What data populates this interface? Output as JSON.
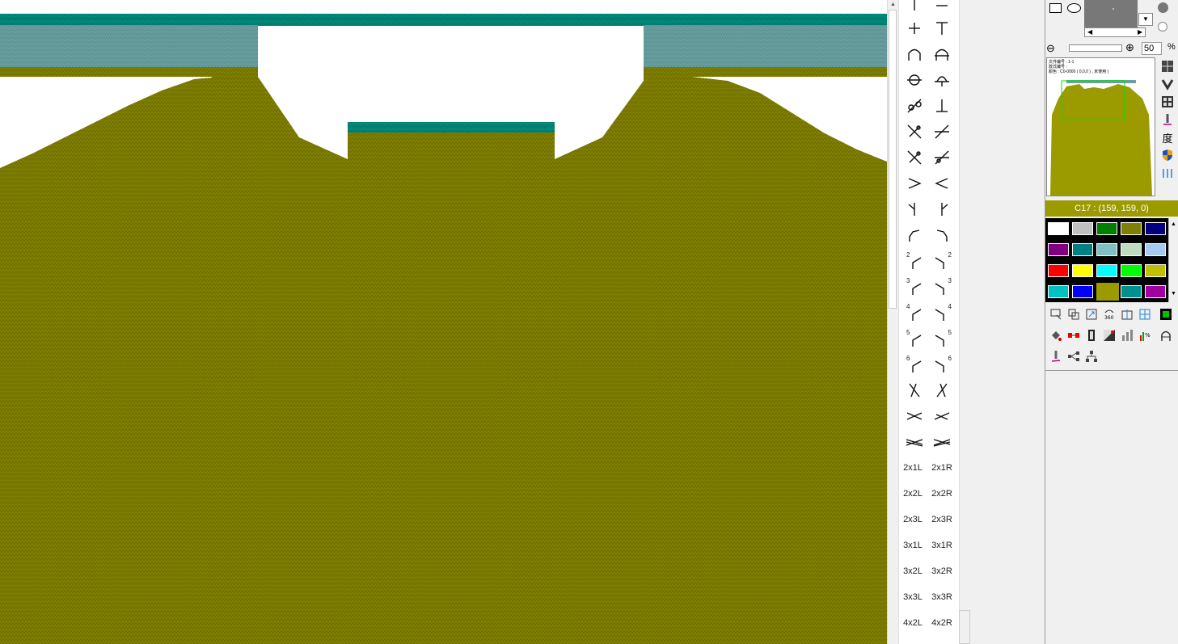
{
  "editor": {
    "colors": {
      "knit": "#808000",
      "knit_dark": "#6a6a00",
      "rib": "#6aa0a0",
      "rib_stripe": "#00897a",
      "background": "#ffffff"
    }
  },
  "symbol_palette": {
    "items": [
      {
        "name": "sym-ttop-l",
        "icon": "line-vertical-top-icon"
      },
      {
        "name": "sym-ttop-r",
        "icon": "line-horizontal-icon"
      },
      {
        "name": "sym-plus",
        "icon": "plus-icon"
      },
      {
        "name": "sym-t",
        "icon": "t-icon"
      },
      {
        "name": "sym-arch",
        "icon": "arch-icon"
      },
      {
        "name": "sym-arch-cross",
        "icon": "arch-cross-icon"
      },
      {
        "name": "sym-circle-line",
        "icon": "circle-line-icon"
      },
      {
        "name": "sym-circle-cross",
        "icon": "circle-cross-icon"
      },
      {
        "name": "sym-slash-circle",
        "icon": "slash-circle-icon"
      },
      {
        "name": "sym-inverted-t",
        "icon": "inverted-t-icon"
      },
      {
        "name": "sym-slash-pair-a",
        "icon": "slash-pair-icon"
      },
      {
        "name": "sym-slash-pair-b",
        "icon": "slash-pair-icon"
      },
      {
        "name": "sym-slash-pair-c",
        "icon": "slash-pair-icon"
      },
      {
        "name": "sym-slash-pair-d",
        "icon": "slash-pair-icon"
      },
      {
        "name": "sym-greater",
        "icon": "greater-than-icon"
      },
      {
        "name": "sym-less",
        "icon": "less-than-icon"
      },
      {
        "name": "sym-y-left",
        "icon": "y-left-icon"
      },
      {
        "name": "sym-y-right",
        "icon": "y-right-icon"
      }
    ],
    "text_items_left": [
      "2x1L",
      "2x2L",
      "2x3L",
      "3x1L",
      "3x2L",
      "3x3L",
      "4x2L"
    ],
    "text_items_right": [
      "2x1R",
      "2x2R",
      "2x3R",
      "3x1R",
      "3x2R",
      "3x3R",
      "4x2R"
    ],
    "move_labels": [
      "2",
      "3",
      "4",
      "5",
      "6"
    ]
  },
  "zoom": {
    "value": "50",
    "unit": "%"
  },
  "preview": {
    "meta_lines": [
      "文件编号 : 1-1",
      "款式编号 :",
      "颜色 : C0-0000 ( 0,0,0 ) , 未使用 )"
    ]
  },
  "side_icons": {
    "degree_label": "度"
  },
  "current_color": {
    "label": "C17 : (159, 159, 0)"
  },
  "palette": {
    "swatches": [
      [
        "#ffffff",
        "#c0c0c0",
        "#008000",
        "#808000",
        "#000080"
      ],
      [
        "#800080",
        "#008080",
        "#80c0c0",
        "#c0dcc0",
        "#a6caf0"
      ],
      [
        "#ff0000",
        "#ffff00",
        "#00ffff",
        "#00ff00",
        "#c0c000"
      ],
      [
        "#00c0c0",
        "#0000ff",
        "#9b9b00",
        "#009090",
        "#a000a0"
      ]
    ]
  }
}
